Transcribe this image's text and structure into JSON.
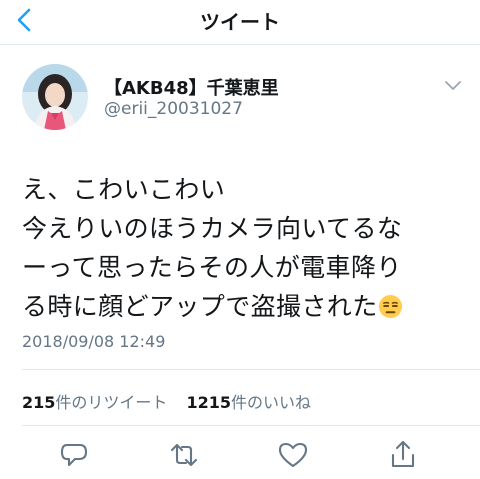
{
  "nav": {
    "title": "ツイート",
    "back_icon": "chevron-left-icon",
    "accent": "#1da1f2"
  },
  "tweet": {
    "display_name": "【AKB48】千葉恵里",
    "handle": "@erii_20031027",
    "text_lines": [
      "え、こわいこわい",
      "今えりいのほうカメラ向いてるな",
      "ーって思ったらその人が電車降り",
      "る時に顔どアップで盗撮された"
    ],
    "emoji": "expressionless-face-icon",
    "timestamp": "2018/09/08 12:49"
  },
  "stats": {
    "retweets": {
      "count": "215",
      "label": "件のリツイート"
    },
    "likes": {
      "count": "1215",
      "label": "件のいいね"
    }
  },
  "actions": [
    "reply-icon",
    "retweet-icon",
    "like-icon",
    "share-icon"
  ],
  "colors": {
    "text": "#14171a",
    "secondary": "#657786",
    "icon": "#657786",
    "divider": "#e1e8ed"
  }
}
